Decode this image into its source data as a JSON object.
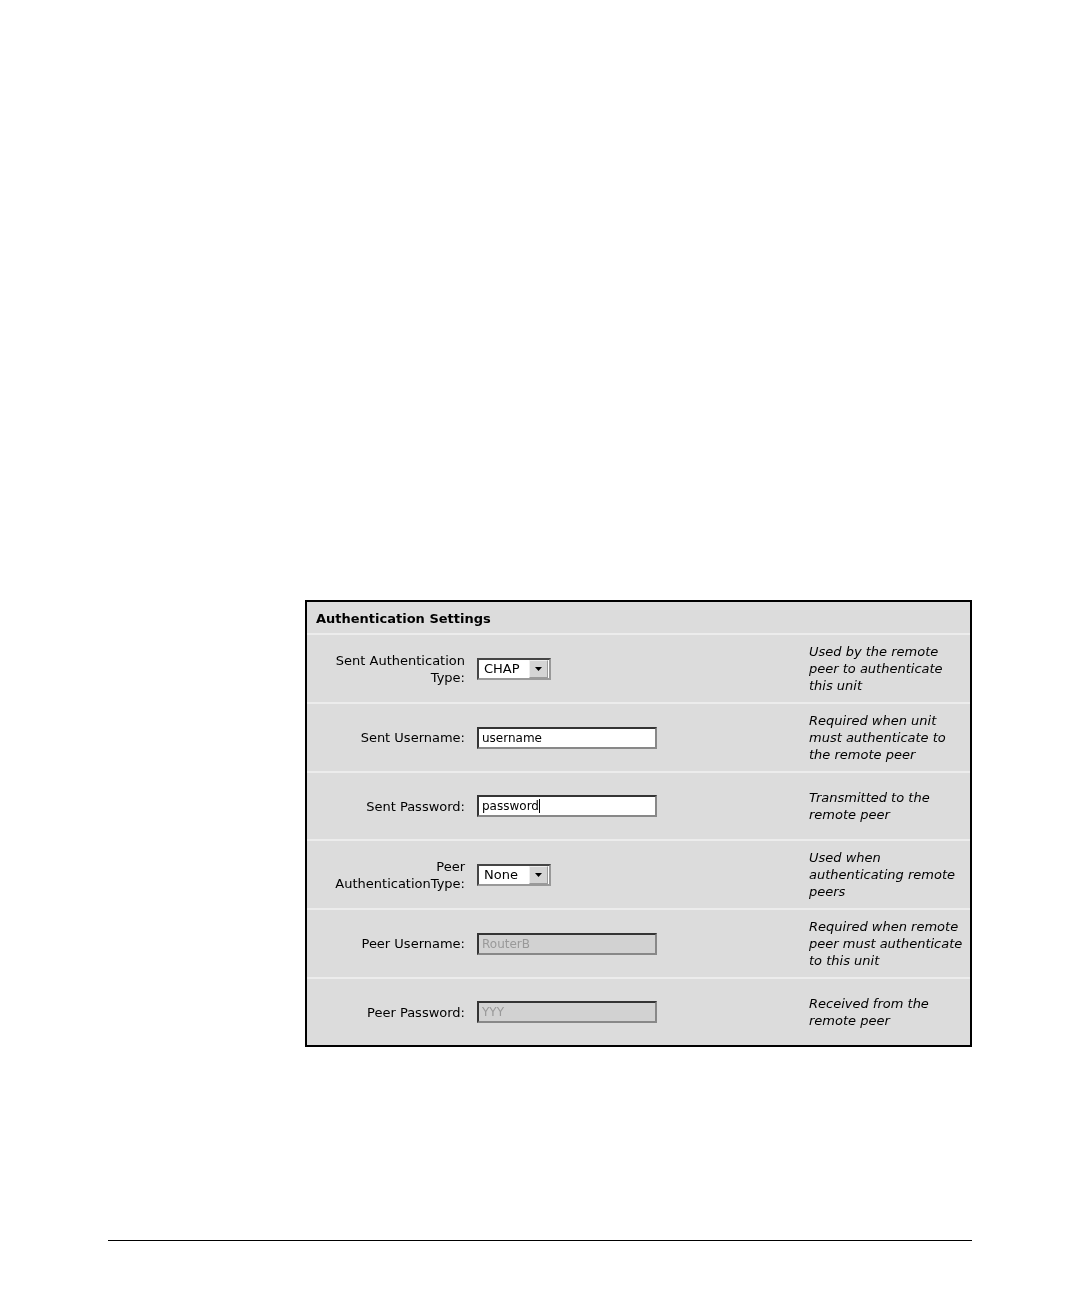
{
  "panel": {
    "title": "Authentication Settings",
    "rows": [
      {
        "kind": "select",
        "label": "Sent Authentication Type:",
        "value": "CHAP",
        "disabled": false,
        "focused": false,
        "hint": "Used by the remote peer to authenticate this unit"
      },
      {
        "kind": "text",
        "label": "Sent Username:",
        "value": "username",
        "disabled": false,
        "focused": false,
        "hint": "Required when unit must authenticate to the remote peer"
      },
      {
        "kind": "text",
        "label": "Sent Password:",
        "value": "password",
        "disabled": false,
        "focused": true,
        "hint": "Transmitted to the remote peer"
      },
      {
        "kind": "select",
        "label": "Peer AuthenticationType:",
        "value": "None",
        "disabled": false,
        "focused": false,
        "hint": "Used when authenticating remote peers"
      },
      {
        "kind": "text",
        "label": "Peer Username:",
        "value": "RouterB",
        "disabled": true,
        "focused": false,
        "hint": "Required when remote peer must authenticate to this unit"
      },
      {
        "kind": "text",
        "label": "Peer Password:",
        "value": "YYY",
        "disabled": true,
        "focused": false,
        "hint": "Received from the remote peer"
      }
    ]
  }
}
